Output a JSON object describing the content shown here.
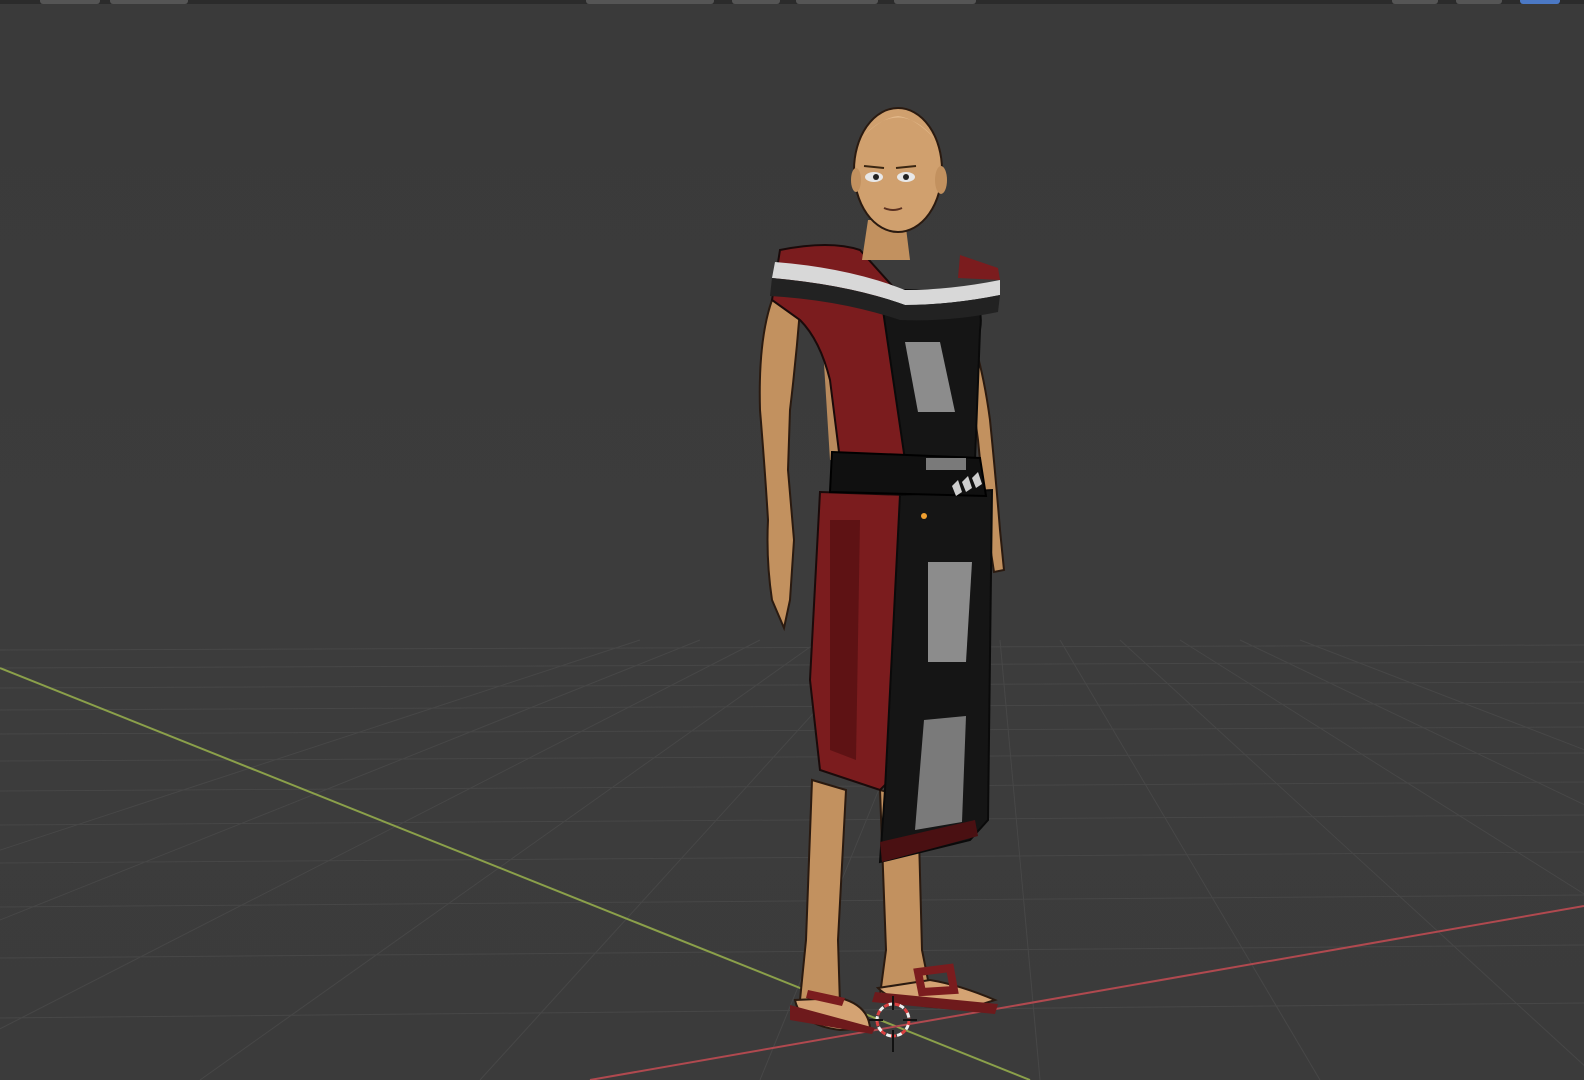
{
  "viewport": {
    "background": "#3b3b3b",
    "grid_color": "#4a4a4a",
    "x_axis_color": "#b0494f",
    "y_axis_color": "#8ba04a"
  },
  "header": {
    "buttons": [
      {
        "icon": "menu-icon"
      },
      {
        "icon": "menu-icon"
      },
      {
        "icon": "mode-icon"
      },
      {
        "icon": "mode-icon"
      },
      {
        "icon": "mode-icon"
      },
      {
        "icon": "mode-icon"
      },
      {
        "icon": "shading-icon"
      },
      {
        "icon": "shading-icon"
      },
      {
        "icon": "shading-solid-icon"
      }
    ]
  },
  "scene": {
    "object": "character",
    "palette": {
      "skin": "#c99a6b",
      "cloth_red": "#7b1c1e",
      "cloth_black": "#151515",
      "cloth_grey": "#8c8c8c",
      "sandal": "#6e1a1c"
    }
  }
}
